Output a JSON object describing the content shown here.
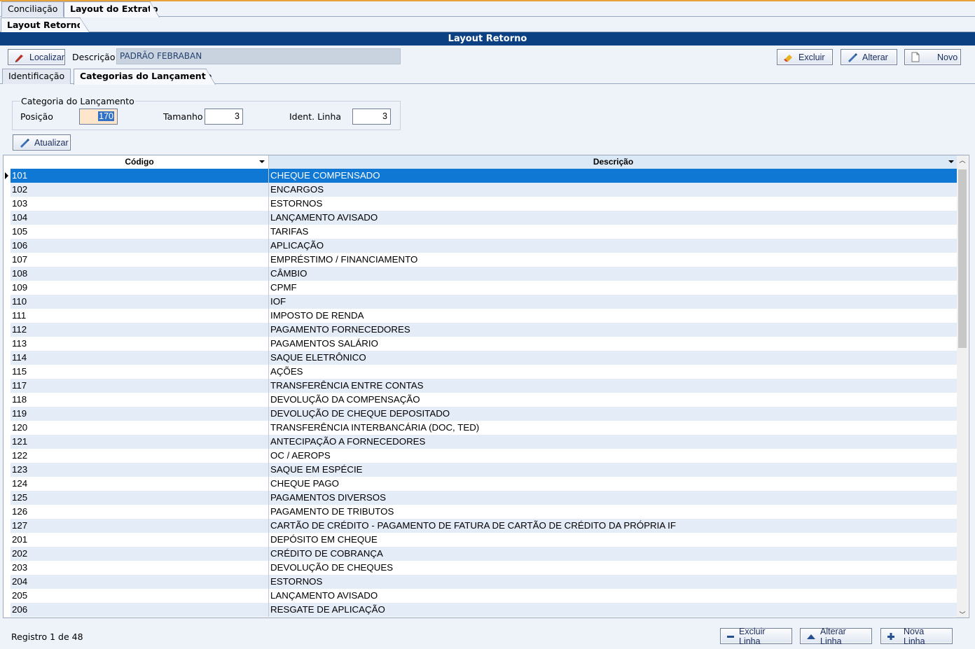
{
  "tabs": {
    "main": [
      {
        "label": "Conciliação"
      },
      {
        "label": "Layout do Extrato"
      }
    ],
    "sub": {
      "label": "Layout Retorno"
    },
    "inner": [
      {
        "label": "Identificação"
      },
      {
        "label": "Categorias do Lançamento"
      }
    ]
  },
  "title": "Layout Retorno",
  "toolbar": {
    "localizar": "Localizar",
    "descricao_label": "Descrição",
    "descricao_value": "PADRÃO FEBRABAN",
    "excluir": "Excluir",
    "alterar": "Alterar",
    "novo": "Novo"
  },
  "categoria": {
    "group_label": "Categoria do Lançamento",
    "posicao_label": "Posição",
    "posicao_value": "170",
    "tamanho_label": "Tamanho",
    "tamanho_value": "3",
    "ident_label": "Ident. Linha",
    "ident_value": "3",
    "atualizar": "Atualizar"
  },
  "grid": {
    "columns": [
      "Código",
      "Descrição"
    ],
    "selected_index": 0,
    "rows": [
      [
        "101",
        "CHEQUE COMPENSADO"
      ],
      [
        "102",
        "ENCARGOS"
      ],
      [
        "103",
        "ESTORNOS"
      ],
      [
        "104",
        "LANÇAMENTO AVISADO"
      ],
      [
        "105",
        "TARIFAS"
      ],
      [
        "106",
        "APLICAÇÃO"
      ],
      [
        "107",
        "EMPRÉSTIMO / FINANCIAMENTO"
      ],
      [
        "108",
        "CÂMBIO"
      ],
      [
        "109",
        "CPMF"
      ],
      [
        "110",
        "IOF"
      ],
      [
        "111",
        "IMPOSTO DE RENDA"
      ],
      [
        "112",
        "PAGAMENTO FORNECEDORES"
      ],
      [
        "113",
        "PAGAMENTOS SALÁRIO"
      ],
      [
        "114",
        "SAQUE ELETRÔNICO"
      ],
      [
        "115",
        "AÇÕES"
      ],
      [
        "117",
        "TRANSFERÊNCIA ENTRE CONTAS"
      ],
      [
        "118",
        "DEVOLUÇÃO DA COMPENSAÇÃO"
      ],
      [
        "119",
        "DEVOLUÇÃO DE CHEQUE DEPOSITADO"
      ],
      [
        "120",
        "TRANSFERÊNCIA INTERBANCÁRIA (DOC, TED)"
      ],
      [
        "121",
        "ANTECIPAÇÃO A FORNECEDORES"
      ],
      [
        "122",
        "OC / AEROPS"
      ],
      [
        "123",
        "SAQUE EM ESPÉCIE"
      ],
      [
        "124",
        "CHEQUE PAGO"
      ],
      [
        "125",
        "PAGAMENTOS DIVERSOS"
      ],
      [
        "126",
        "PAGAMENTO DE TRIBUTOS"
      ],
      [
        "127",
        "CARTÃO DE CRÉDITO - PAGAMENTO DE FATURA DE CARTÃO DE CRÉDITO DA PRÓPRIA IF"
      ],
      [
        "201",
        "DEPÓSITO EM CHEQUE"
      ],
      [
        "202",
        "CRÉDITO DE COBRANÇA"
      ],
      [
        "203",
        "DEVOLUÇÃO DE CHEQUES"
      ],
      [
        "204",
        "ESTORNOS"
      ],
      [
        "205",
        "LANÇAMENTO AVISADO"
      ],
      [
        "206",
        "RESGATE DE APLICAÇÃO"
      ]
    ]
  },
  "footer": {
    "status": "Registro 1 de 48",
    "excluir_linha": "Excluir Linha",
    "alterar_linha": "Alterar Linha",
    "nova_linha": "Nova Linha"
  },
  "colors": {
    "title_bar": "#0b4183",
    "selection": "#0f78d4",
    "alt_row": "#e4ecf8"
  }
}
